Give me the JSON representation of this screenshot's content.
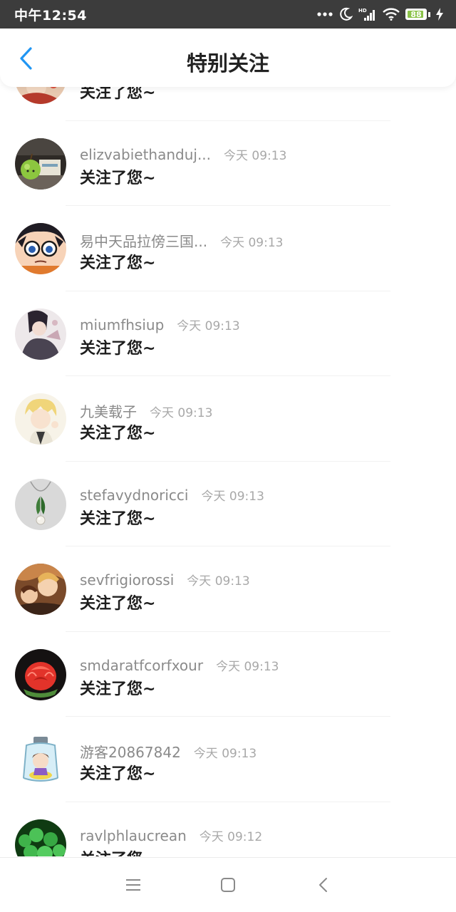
{
  "status_bar": {
    "time": "中午12:54",
    "battery": "88",
    "icons": [
      "more-dots-icon",
      "moon-icon",
      "hd-signal-icon",
      "wifi-icon",
      "battery-icon",
      "charging-icon"
    ]
  },
  "header": {
    "title": "特别关注",
    "back_icon": "chevron-left-icon",
    "accent_color": "#2196f3"
  },
  "list": {
    "items": [
      {
        "username": "",
        "time": "",
        "message": "关注了您~",
        "avatar": "anime-girl-red"
      },
      {
        "username": "elizvabiethanduj...",
        "time": "今天 09:13",
        "message": "关注了您~",
        "avatar": "green-apple"
      },
      {
        "username": "易中天品拉傍三国...",
        "time": "今天 09:13",
        "message": "关注了您~",
        "avatar": "detective-boy-glasses"
      },
      {
        "username": "miumfhsiup",
        "time": "今天 09:13",
        "message": "关注了您~",
        "avatar": "anime-boy-dark"
      },
      {
        "username": "九美载子",
        "time": "今天 09:13",
        "message": "关注了您~",
        "avatar": "anime-boy-blond"
      },
      {
        "username": "stefavydnoricci",
        "time": "今天 09:13",
        "message": "关注了您~",
        "avatar": "pearl-pendant"
      },
      {
        "username": "sevfrigiorossi",
        "time": "今天 09:13",
        "message": "关注了您~",
        "avatar": "anime-couple"
      },
      {
        "username": "smdaratfcorfxour",
        "time": "今天 09:13",
        "message": "关注了您~",
        "avatar": "watermelon-rose"
      },
      {
        "username": "游客20867842",
        "time": "今天 09:13",
        "message": "关注了您~",
        "avatar": "girl-in-jar"
      },
      {
        "username": "ravlphlaucrean",
        "time": "今天 09:12",
        "message": "关注了您~",
        "avatar": "green-clover"
      }
    ]
  },
  "nav_bar": {
    "icons": [
      "menu-icon",
      "home-square-icon",
      "back-triangle-icon"
    ]
  }
}
